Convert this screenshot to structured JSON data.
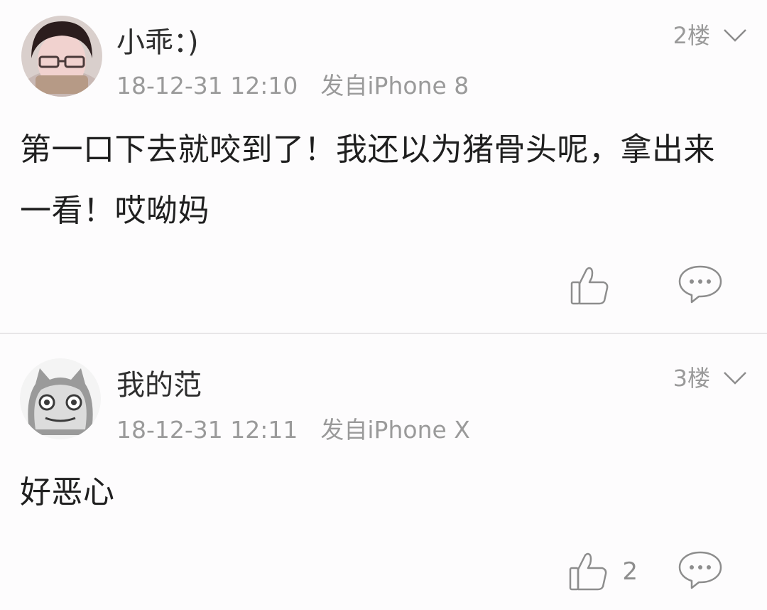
{
  "comments": [
    {
      "username": "小乖：)",
      "timestamp": "18-12-31 12:10",
      "device": "发自iPhone 8",
      "floor": "2楼",
      "text": "第一口下去就咬到了！我还以为猪骨头呢，拿出来一看！哎呦妈",
      "like_count": "",
      "icons": {
        "like": "thumbs-up-icon",
        "reply": "chat-bubble-icon",
        "menu": "chevron-down-icon"
      }
    },
    {
      "username": "我的范",
      "timestamp": "18-12-31 12:11",
      "device": "发自iPhone X",
      "floor": "3楼",
      "text": "好恶心",
      "like_count": "2",
      "icons": {
        "like": "thumbs-up-icon",
        "reply": "chat-bubble-icon",
        "menu": "chevron-down-icon"
      }
    }
  ],
  "colors": {
    "background": "#fdfcfd",
    "primary_text": "#1f1f1f",
    "secondary_text": "#9a9a9a",
    "icon": "#8d8d8d",
    "divider": "#e8e6e8"
  }
}
